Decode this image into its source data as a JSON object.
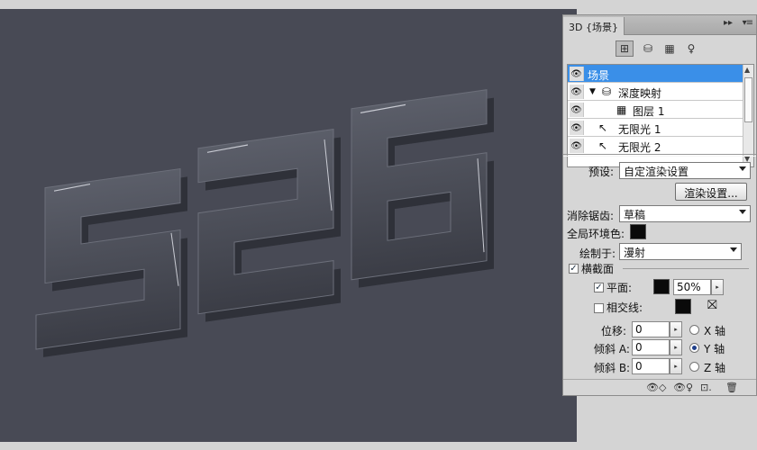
{
  "panel": {
    "tab_title": "3D {场景}",
    "collapse_glyph": "▸▸",
    "menu_glyph": "▾≡",
    "toolbar": [
      {
        "name": "scene-filter-icon",
        "glyph": "⊞",
        "active": true
      },
      {
        "name": "mesh-filter-icon",
        "glyph": "⛁",
        "active": false
      },
      {
        "name": "material-filter-icon",
        "glyph": "▦",
        "active": false
      },
      {
        "name": "light-filter-icon",
        "glyph": "♀",
        "active": false
      }
    ],
    "layers": [
      {
        "label": "场景",
        "eye": "👁",
        "selected": true
      },
      {
        "label": "深度映射",
        "eye": "👁",
        "selected": false
      },
      {
        "label": "图层 1",
        "eye": "👁",
        "selected": false
      },
      {
        "label": "无限光 1",
        "eye": "👁",
        "selected": false
      },
      {
        "label": "无限光 2",
        "eye": "👁",
        "selected": false
      }
    ],
    "preset_label": "预设:",
    "preset_value": "自定渲染设置",
    "render_settings_button": "渲染设置...",
    "antialias_label": "消除锯齿:",
    "antialias_value": "草稿",
    "global_ambient_label": "全局环境色:",
    "paint_on_label": "绘制于:",
    "paint_on_value": "漫射",
    "cross_section_label": "横截面",
    "cross_section_checked": "✓",
    "plane_label": "平面:",
    "plane_checked": "✓",
    "plane_opacity": "50%",
    "intersect_label": "相交线:",
    "offset_label": "位移:",
    "offset_value": "0",
    "tilt_a_label": "倾斜 A:",
    "tilt_a_value": "0",
    "tilt_b_label": "倾斜 B:",
    "tilt_b_value": "0",
    "x_axis_label": "X 轴",
    "y_axis_label": "Y 轴",
    "z_axis_label": "Z 轴",
    "selected_axis": "Y"
  },
  "canvas": {
    "artwork_text": "526",
    "background_color": "#484a55"
  }
}
